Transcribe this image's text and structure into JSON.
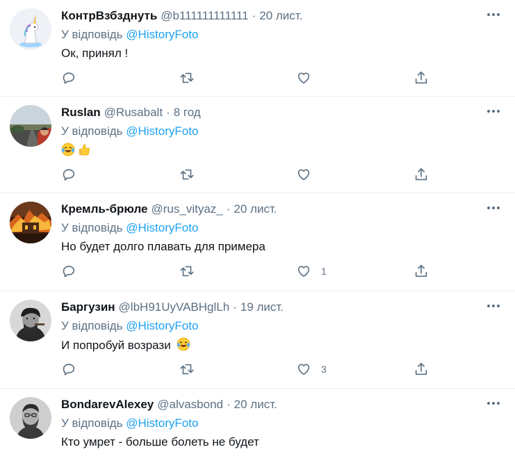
{
  "reply_prefix": "У відповідь",
  "mention": "@HistoryFoto",
  "tweets": [
    {
      "name": "КонтрВзбзднуть",
      "handle": "@b111111111111",
      "time": "20 лист.",
      "text": "Ок, принял !",
      "emojis": [],
      "replies": "",
      "retweets": "",
      "likes": "",
      "avatar_icon": "unicorn-avatar"
    },
    {
      "name": "Ruslan",
      "handle": "@Rusabalt",
      "time": "8 год",
      "text": "",
      "emojis": [
        "tears-of-joy",
        "thumbs-up"
      ],
      "replies": "",
      "retweets": "",
      "likes": "",
      "avatar_icon": "road-landscape-avatar"
    },
    {
      "name": "Кремль-брюле",
      "handle": "@rus_vityaz_",
      "time": "20 лист.",
      "text": "Но будет долго плавать для примера",
      "emojis": [],
      "replies": "",
      "retweets": "",
      "likes": "1",
      "avatar_icon": "burning-building-avatar"
    },
    {
      "name": "Баргузин",
      "handle": "@lbH91UyVABHglLh",
      "time": "19 лист.",
      "text": "И попробуй возрази",
      "emojis": [
        "tears-of-joy"
      ],
      "replies": "",
      "retweets": "",
      "likes": "3",
      "avatar_icon": "man-with-cigar-avatar"
    },
    {
      "name": "BondarevAlexey",
      "handle": "@alvasbond",
      "time": "20 лист.",
      "text": "Кто умрет - больше болеть не будет",
      "emojis": [],
      "replies": "",
      "retweets": "",
      "likes": "",
      "avatar_icon": "bearded-man-avatar"
    }
  ],
  "colors": {
    "text": "#0f1419",
    "secondary": "#5b7083",
    "link": "#1da1f2",
    "divider": "#ebeef0"
  }
}
